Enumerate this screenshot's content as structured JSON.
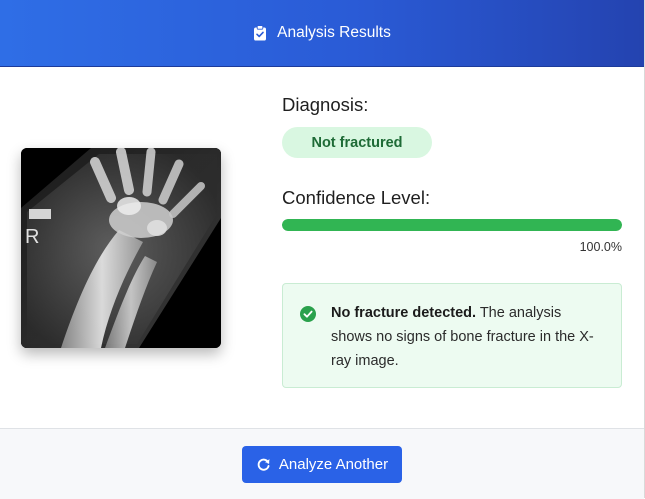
{
  "header": {
    "title": "Analysis Results",
    "icon": "clipboard-check-icon"
  },
  "image": {
    "marker_text": "R"
  },
  "diagnosis": {
    "label": "Diagnosis:",
    "result": "Not fractured",
    "result_color": "#1e6b36"
  },
  "confidence": {
    "label": "Confidence Level:",
    "value": 100.0,
    "value_text": "100.0%"
  },
  "alert": {
    "icon": "check-circle-icon",
    "bold_text": "No fracture detected.",
    "text": " The analysis shows no signs of bone fracture in the X-ray image."
  },
  "footer": {
    "button_label": "Analyze Another",
    "button_icon": "refresh-icon",
    "accent": "#2a62e7"
  }
}
